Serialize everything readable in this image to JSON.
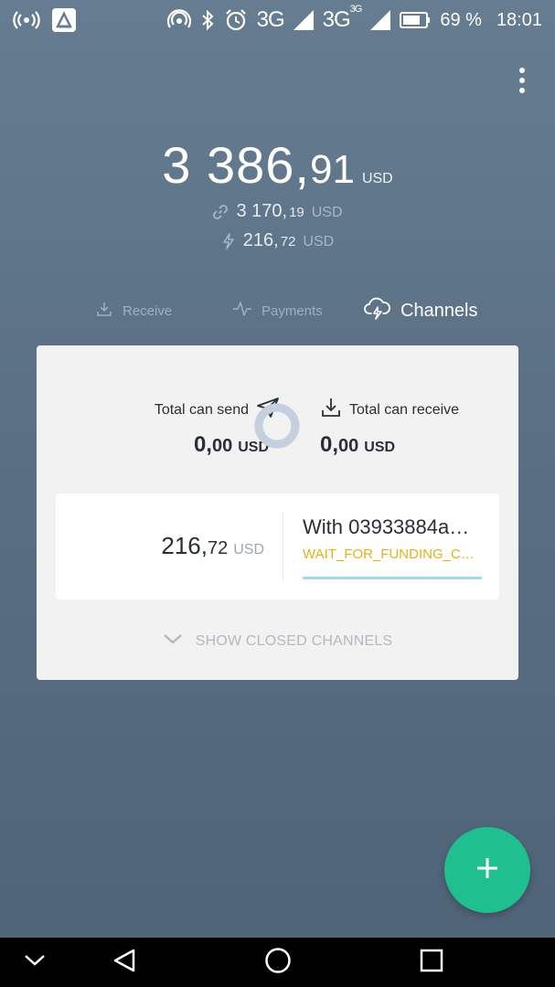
{
  "status_bar": {
    "battery_percent": "69 %",
    "time": "18:01",
    "network_1": "3G",
    "network_2": "3G",
    "network_2_sup": "3G",
    "icons": [
      "hotspot-icon",
      "app-notification-icon",
      "nfc-icon",
      "bluetooth-icon",
      "alarm-icon",
      "signal-icon",
      "battery-icon"
    ]
  },
  "balance": {
    "integer": "3 386,",
    "decimal": "91",
    "currency": "USD",
    "onchain": {
      "integer": "3 170,",
      "decimal": "19",
      "currency": "USD",
      "icon": "link-icon"
    },
    "lightning": {
      "integer": "216,",
      "decimal": "72",
      "currency": "USD",
      "icon": "lightning-icon"
    }
  },
  "tabs": [
    {
      "label": "Receive",
      "icon": "download-icon",
      "active": false
    },
    {
      "label": "Payments",
      "icon": "activity-icon",
      "active": false
    },
    {
      "label": "Channels",
      "icon": "cloud-lightning-icon",
      "active": true
    }
  ],
  "channels_card": {
    "total_send": {
      "label": "Total can send",
      "integer": "0,",
      "decimal": "00",
      "currency": "USD",
      "icon": "send-icon"
    },
    "total_receive": {
      "label": "Total can receive",
      "integer": "0,",
      "decimal": "00",
      "currency": "USD",
      "icon": "download-icon"
    },
    "channel": {
      "amount_integer": "216,",
      "amount_decimal": "72",
      "currency": "USD",
      "peer": "With 03933884a…",
      "status": "WAIT_FOR_FUNDING_C…"
    },
    "show_closed_label": "SHOW CLOSED CHANNELS"
  },
  "colors": {
    "accent_green": "#1fbf8f",
    "status_yellow": "#e3b118",
    "progress_blue": "#9fd8ef"
  }
}
